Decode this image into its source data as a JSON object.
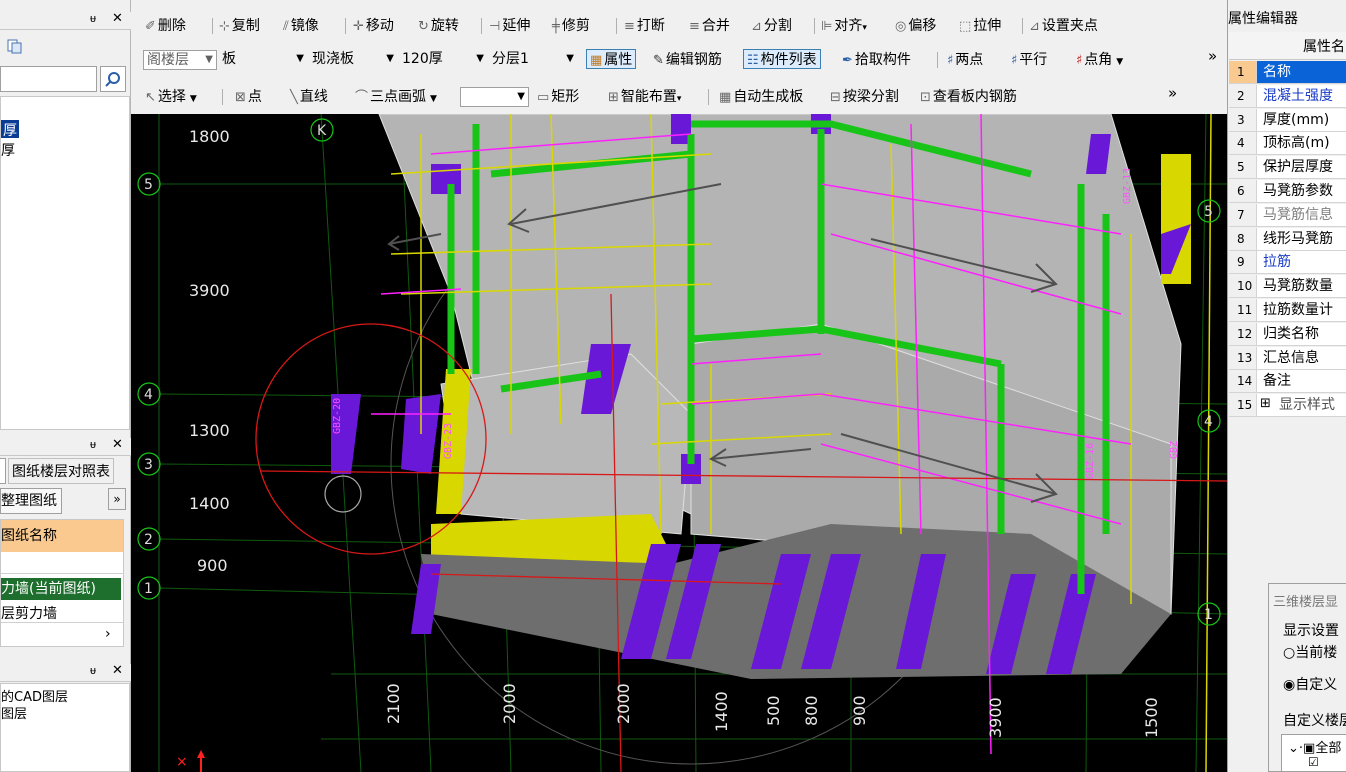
{
  "left_panel": {
    "top_items": [
      "厚",
      "厚"
    ],
    "layer_tab": "图纸楼层对照表",
    "organize_button": "整理图纸",
    "drawing_header": "图纸名称",
    "drawing_rows": [
      "",
      "力墙(当前图纸)",
      "层剪力墙"
    ],
    "cad_layers": [
      "的CAD图层",
      "图层"
    ]
  },
  "toolbar1": {
    "delete": "删除",
    "copy": "复制",
    "mirror": "镜像",
    "move": "移动",
    "rotate": "旋转",
    "extend": "延伸",
    "trim": "修剪",
    "break": "打断",
    "merge": "合并",
    "split": "分割",
    "align": "对齐",
    "offset": "偏移",
    "stretch": "拉伸",
    "set_grip": "设置夹点"
  },
  "toolbar2": {
    "floor_combo": "阁楼层",
    "type_combo": "板",
    "subtype_combo": "现浇板",
    "thickness_combo": "120厚",
    "layer_combo": "分层1",
    "properties": "属性",
    "edit_rebar": "编辑钢筋",
    "component_list": "构件列表",
    "pick_component": "拾取构件",
    "two_points": "两点",
    "parallel": "平行",
    "point_angle": "点角",
    "more": "»"
  },
  "toolbar3": {
    "select": "选择",
    "point": "点",
    "line": "直线",
    "arc3": "三点画弧",
    "blank_combo": "",
    "rect": "矩形",
    "smart_layout": "智能布置",
    "auto_slab": "自动生成板",
    "beam_split": "按梁分割",
    "view_rebar": "查看板内钢筋",
    "more": "»"
  },
  "viewport": {
    "left_dims": [
      "1800",
      "3900",
      "1300",
      "1400",
      "900"
    ],
    "bottom_dims": [
      "2100",
      "2000",
      "2000",
      "1400",
      "500",
      "800",
      "900",
      "3900",
      "1500"
    ],
    "left_axes": [
      "5",
      "4",
      "3",
      "2",
      "1"
    ],
    "right_axes": [
      "5",
      "4",
      "1"
    ],
    "top_axis": "K",
    "labels": [
      "GBZ-20",
      "GBZ-23",
      "GBZ-13",
      "GBZ-16",
      "GBZ"
    ],
    "colors": {
      "green": "#18c418",
      "purple": "#6a18d8",
      "yellow": "#d8d800",
      "magenta": "#ff20ff",
      "gray": "#b4b4b4"
    }
  },
  "right_panel": {
    "title": "属性编辑器",
    "col_header": "属性名",
    "rows": [
      {
        "n": "1",
        "name": "名称"
      },
      {
        "n": "2",
        "name": "混凝土强度"
      },
      {
        "n": "3",
        "name": "厚度(mm)"
      },
      {
        "n": "4",
        "name": "顶标高(m)"
      },
      {
        "n": "5",
        "name": "保护层厚度"
      },
      {
        "n": "6",
        "name": "马凳筋参数"
      },
      {
        "n": "7",
        "name": "马凳筋信息"
      },
      {
        "n": "8",
        "name": "线形马凳筋"
      },
      {
        "n": "9",
        "name": "拉筋"
      },
      {
        "n": "10",
        "name": "马凳筋数量"
      },
      {
        "n": "11",
        "name": "拉筋数量计"
      },
      {
        "n": "12",
        "name": "归类名称"
      },
      {
        "n": "13",
        "name": "汇总信息"
      },
      {
        "n": "14",
        "name": "备注"
      },
      {
        "n": "15",
        "name": "显示样式"
      }
    ],
    "dialog_title": "三维楼层显",
    "display_settings": "显示设置",
    "current_floor": "当前楼",
    "custom": "自定义",
    "custom_floor": "自定义楼层",
    "tree_item": "全部"
  }
}
